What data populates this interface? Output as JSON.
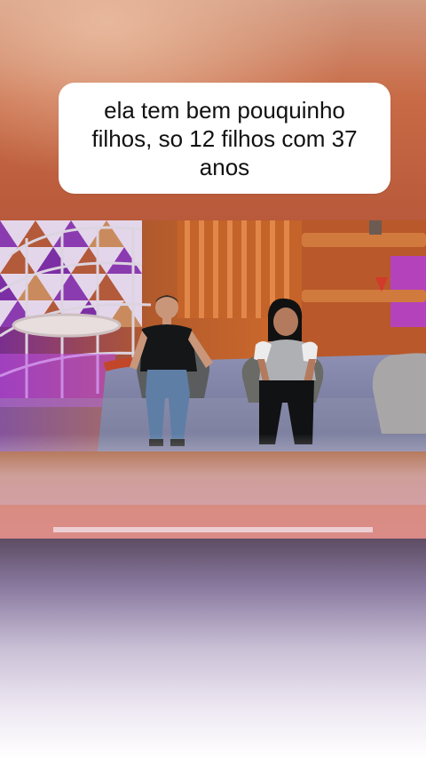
{
  "caption": {
    "text": "ela tem bem pouquinho filhos, so 12 filhos com 37 anos"
  },
  "video": {
    "scene": "tv-studio-talk-show"
  },
  "colors": {
    "caption_bg": "#ffffff",
    "caption_text": "#111111",
    "studio_orange": "#c8602f",
    "studio_purple": "#b33fe0",
    "floor_blue": "#7f86a8"
  }
}
